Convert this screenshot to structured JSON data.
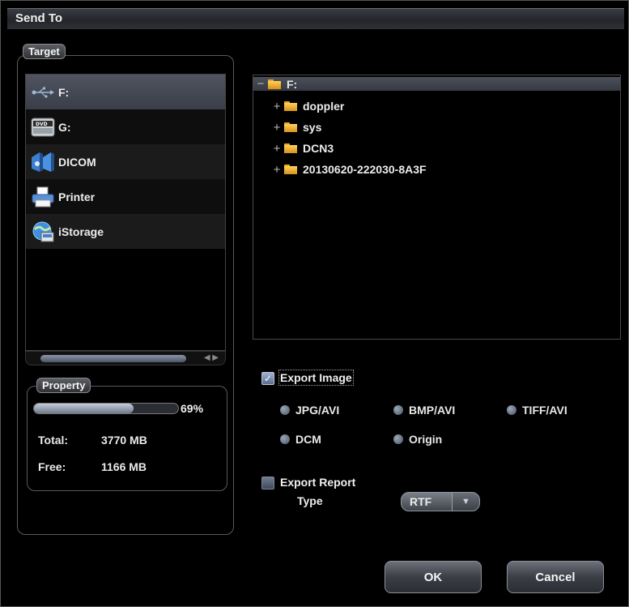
{
  "window": {
    "title": "Send To"
  },
  "target": {
    "legend": "Target",
    "items": [
      {
        "label": "F:",
        "icon": "usb-icon",
        "selected": true
      },
      {
        "label": "G:",
        "icon": "dvd-drive-icon",
        "selected": false
      },
      {
        "label": "DICOM",
        "icon": "dicom-network-icon",
        "selected": false
      },
      {
        "label": "Printer",
        "icon": "printer-icon",
        "selected": false
      },
      {
        "label": "iStorage",
        "icon": "globe-storage-icon",
        "selected": false
      }
    ]
  },
  "property": {
    "legend": "Property",
    "used_fraction": 0.69,
    "used_percent": "69%",
    "total_label": "Total:",
    "total_value": "3770 MB",
    "free_label": "Free:",
    "free_value": "1166 MB"
  },
  "tree": {
    "root": "F:",
    "children": [
      "doppler",
      "sys",
      "DCN3",
      "20130620-222030-8A3F"
    ]
  },
  "export_image": {
    "label": "Export Image",
    "checked": true,
    "formats": [
      "JPG/AVI",
      "BMP/AVI",
      "TIFF/AVI",
      "DCM",
      "Origin"
    ]
  },
  "export_report": {
    "label": "Export Report",
    "checked": false,
    "type_label": "Type",
    "type_value": "RTF"
  },
  "buttons": {
    "ok": "OK",
    "cancel": "Cancel"
  },
  "colors": {
    "accent": "#4f5460",
    "folder": "#ffd25a",
    "background": "#000000"
  }
}
